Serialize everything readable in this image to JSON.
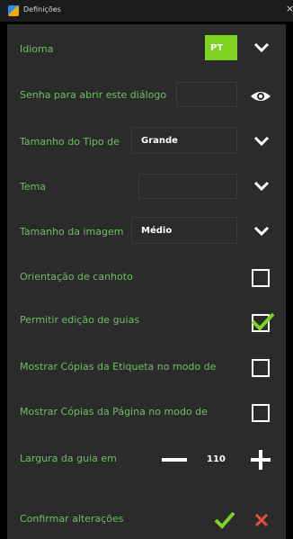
{
  "window": {
    "title": "Definições",
    "close": "×"
  },
  "settings": {
    "language": {
      "label": "Idioma",
      "value": "PT"
    },
    "password": {
      "label": "Senha para abrir este diálogo",
      "value": ""
    },
    "font_size": {
      "label": "Tamanho do Tipo de",
      "value": "Grande"
    },
    "theme": {
      "label": "Tema",
      "value": ""
    },
    "image_size": {
      "label": "Tamanho da imagem",
      "value": "Médio"
    },
    "left_hand": {
      "label": "Orientação de canhoto",
      "checked": false
    },
    "edit_guides": {
      "label": "Permitir edição de guias",
      "checked": true
    },
    "show_label_copies": {
      "label": "Mostrar Cópias da Etiqueta no modo de",
      "checked": false
    },
    "show_page_copies": {
      "label": "Mostrar Cópias da Página no modo de",
      "checked": false
    },
    "guide_width": {
      "label": "Largura da guia em",
      "value": "110"
    },
    "confirm": {
      "label": "Confirmar alterações"
    }
  },
  "colors": {
    "accent_green": "#7ed321",
    "label_green": "#6ebe63",
    "cancel_red": "#e74c3c"
  },
  "icons": {
    "dropdown": "chevron-down-icon",
    "password_toggle": "eye-icon",
    "confirm": "check-icon",
    "cancel": "close-icon",
    "decrease": "minus-icon",
    "increase": "plus-icon"
  }
}
